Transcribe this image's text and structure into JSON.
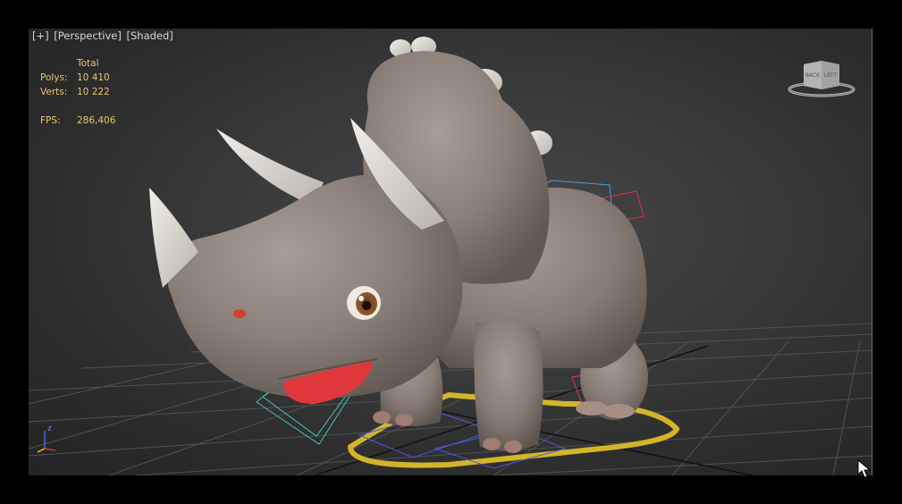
{
  "viewport": {
    "labels": [
      "[+]",
      "[Perspective]",
      "[Shaded]"
    ]
  },
  "stats": {
    "total_label": "Total",
    "polys_label": "Polys:",
    "polys_value": "10 410",
    "verts_label": "Verts:",
    "verts_value": "10 222",
    "fps_label": "FPS:",
    "fps_value": "286,406"
  },
  "viewcube": {
    "face_left": "BACK",
    "face_right": "LEFT"
  },
  "axis": {
    "z_label": "z"
  },
  "colors": {
    "viewport_bg": "#3a3a3a",
    "stats_text": "#e7c86a",
    "model_body": "#8a7f78",
    "tongue": "#e0383a",
    "ground_ring": "#d4b52a"
  }
}
